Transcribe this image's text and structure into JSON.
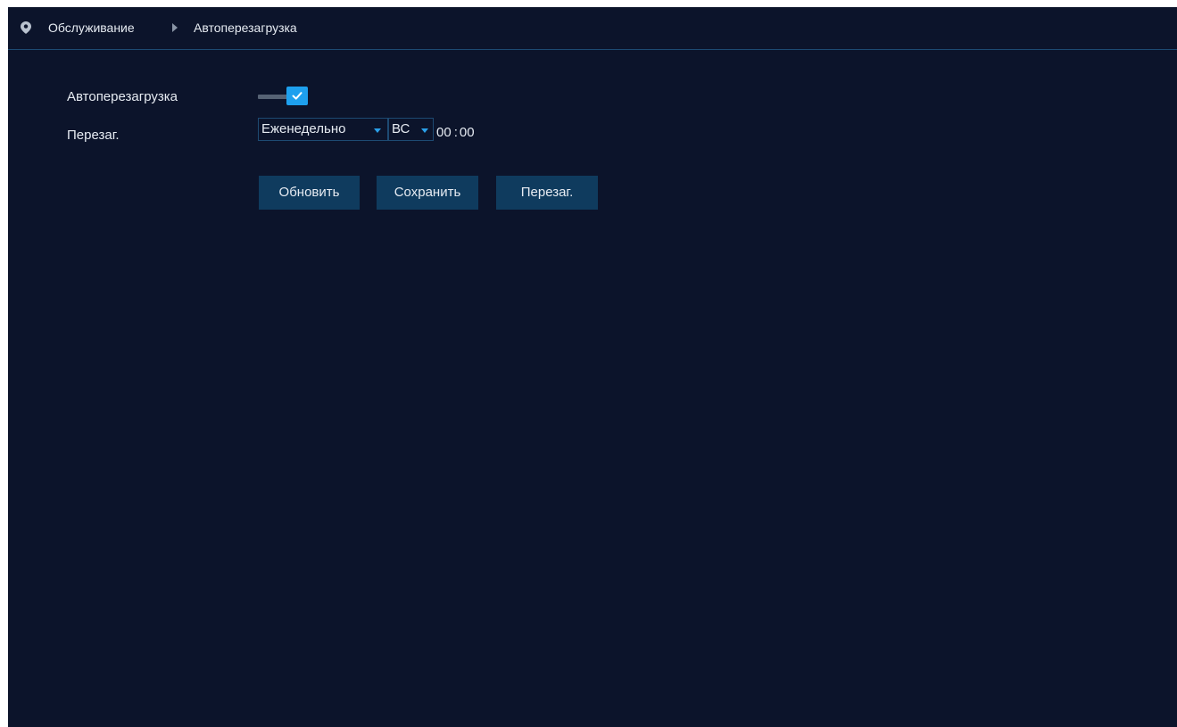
{
  "breadcrumb": {
    "items": [
      {
        "label": "Обслуживание"
      },
      {
        "label": "Автоперезагрузка"
      }
    ]
  },
  "form": {
    "auto_reboot": {
      "label": "Автоперезагрузка",
      "enabled": true
    },
    "reboot": {
      "label": "Перезаг.",
      "period": "Еженедельно",
      "day": "ВС",
      "hour": "00",
      "time_separator": ":",
      "minute": "00"
    }
  },
  "buttons": {
    "refresh": "Обновить",
    "save": "Сохранить",
    "reboot": "Перезаг."
  },
  "colors": {
    "background": "#0c142b",
    "accent": "#1ea0ee",
    "button": "#0f3b5e",
    "text": "#e6ebf2"
  }
}
